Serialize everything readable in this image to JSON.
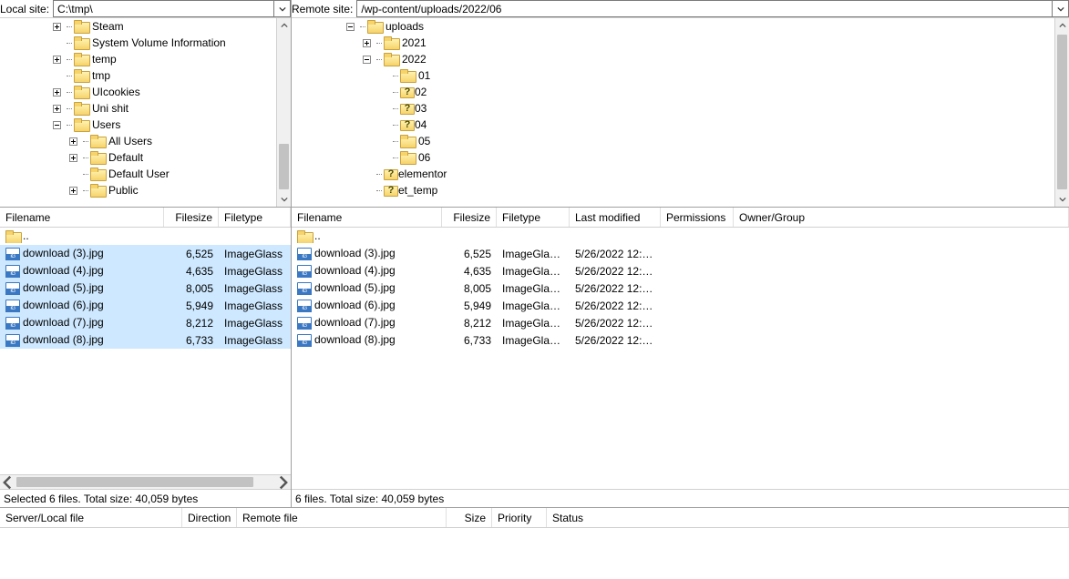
{
  "path": {
    "local_label": "Local site:",
    "local_value": "C:\\tmp\\",
    "remote_label": "Remote site:",
    "remote_value": "/wp-content/uploads/2022/06"
  },
  "local_tree": [
    {
      "depth": 2,
      "exp": "plus",
      "icon": "folder",
      "label": "Steam"
    },
    {
      "depth": 2,
      "exp": "none",
      "icon": "folder",
      "label": "System Volume Information"
    },
    {
      "depth": 2,
      "exp": "plus",
      "icon": "folder",
      "label": "temp"
    },
    {
      "depth": 2,
      "exp": "none",
      "icon": "folder",
      "label": "tmp"
    },
    {
      "depth": 2,
      "exp": "plus",
      "icon": "folder",
      "label": "UIcookies"
    },
    {
      "depth": 2,
      "exp": "plus",
      "icon": "folder",
      "label": "Uni shit"
    },
    {
      "depth": 2,
      "exp": "minus",
      "icon": "folder",
      "label": "Users"
    },
    {
      "depth": 3,
      "exp": "plus",
      "icon": "folder",
      "label": "All Users"
    },
    {
      "depth": 3,
      "exp": "plus",
      "icon": "folder",
      "label": "Default"
    },
    {
      "depth": 3,
      "exp": "none",
      "icon": "folder",
      "label": "Default User"
    },
    {
      "depth": 3,
      "exp": "plus",
      "icon": "folder",
      "label": "Public"
    }
  ],
  "remote_tree": [
    {
      "depth": 1,
      "exp": "minus",
      "icon": "folder",
      "label": "uploads"
    },
    {
      "depth": 2,
      "exp": "plus",
      "icon": "folder",
      "label": "2021"
    },
    {
      "depth": 2,
      "exp": "minus",
      "icon": "folder",
      "label": "2022"
    },
    {
      "depth": 3,
      "exp": "none",
      "icon": "folder",
      "label": "01"
    },
    {
      "depth": 3,
      "exp": "none",
      "icon": "folder-q",
      "label": "02"
    },
    {
      "depth": 3,
      "exp": "none",
      "icon": "folder-q",
      "label": "03"
    },
    {
      "depth": 3,
      "exp": "none",
      "icon": "folder-q",
      "label": "04"
    },
    {
      "depth": 3,
      "exp": "none",
      "icon": "folder",
      "label": "05"
    },
    {
      "depth": 3,
      "exp": "none",
      "icon": "folder",
      "label": "06"
    },
    {
      "depth": 2,
      "exp": "none",
      "icon": "folder-q",
      "label": "elementor"
    },
    {
      "depth": 2,
      "exp": "none",
      "icon": "folder-q",
      "label": "et_temp"
    }
  ],
  "local_list": {
    "columns": {
      "name": "Filename",
      "size": "Filesize",
      "type": "Filetype"
    },
    "parent": "..",
    "rows": [
      {
        "name": "download (3).jpg",
        "size": "6,525",
        "type": "ImageGlass"
      },
      {
        "name": "download (4).jpg",
        "size": "4,635",
        "type": "ImageGlass"
      },
      {
        "name": "download (5).jpg",
        "size": "8,005",
        "type": "ImageGlass"
      },
      {
        "name": "download (6).jpg",
        "size": "5,949",
        "type": "ImageGlass"
      },
      {
        "name": "download (7).jpg",
        "size": "8,212",
        "type": "ImageGlass"
      },
      {
        "name": "download (8).jpg",
        "size": "6,733",
        "type": "ImageGlass"
      }
    ],
    "status": "Selected 6 files. Total size: 40,059 bytes"
  },
  "remote_list": {
    "columns": {
      "name": "Filename",
      "size": "Filesize",
      "type": "Filetype",
      "mod": "Last modified",
      "perm": "Permissions",
      "own": "Owner/Group"
    },
    "parent": "..",
    "rows": [
      {
        "name": "download (3).jpg",
        "size": "6,525",
        "type": "ImageGlas...",
        "mod": "5/26/2022 12:0..."
      },
      {
        "name": "download (4).jpg",
        "size": "4,635",
        "type": "ImageGlas...",
        "mod": "5/26/2022 12:0..."
      },
      {
        "name": "download (5).jpg",
        "size": "8,005",
        "type": "ImageGlas...",
        "mod": "5/26/2022 12:0..."
      },
      {
        "name": "download (6).jpg",
        "size": "5,949",
        "type": "ImageGlas...",
        "mod": "5/26/2022 12:0..."
      },
      {
        "name": "download (7).jpg",
        "size": "8,212",
        "type": "ImageGlas...",
        "mod": "5/26/2022 12:0..."
      },
      {
        "name": "download (8).jpg",
        "size": "6,733",
        "type": "ImageGlas...",
        "mod": "5/26/2022 12:0..."
      }
    ],
    "status": "6 files. Total size: 40,059 bytes"
  },
  "queue": {
    "columns": {
      "server": "Server/Local file",
      "dir": "Direction",
      "remote": "Remote file",
      "size": "Size",
      "prio": "Priority",
      "status": "Status"
    }
  }
}
